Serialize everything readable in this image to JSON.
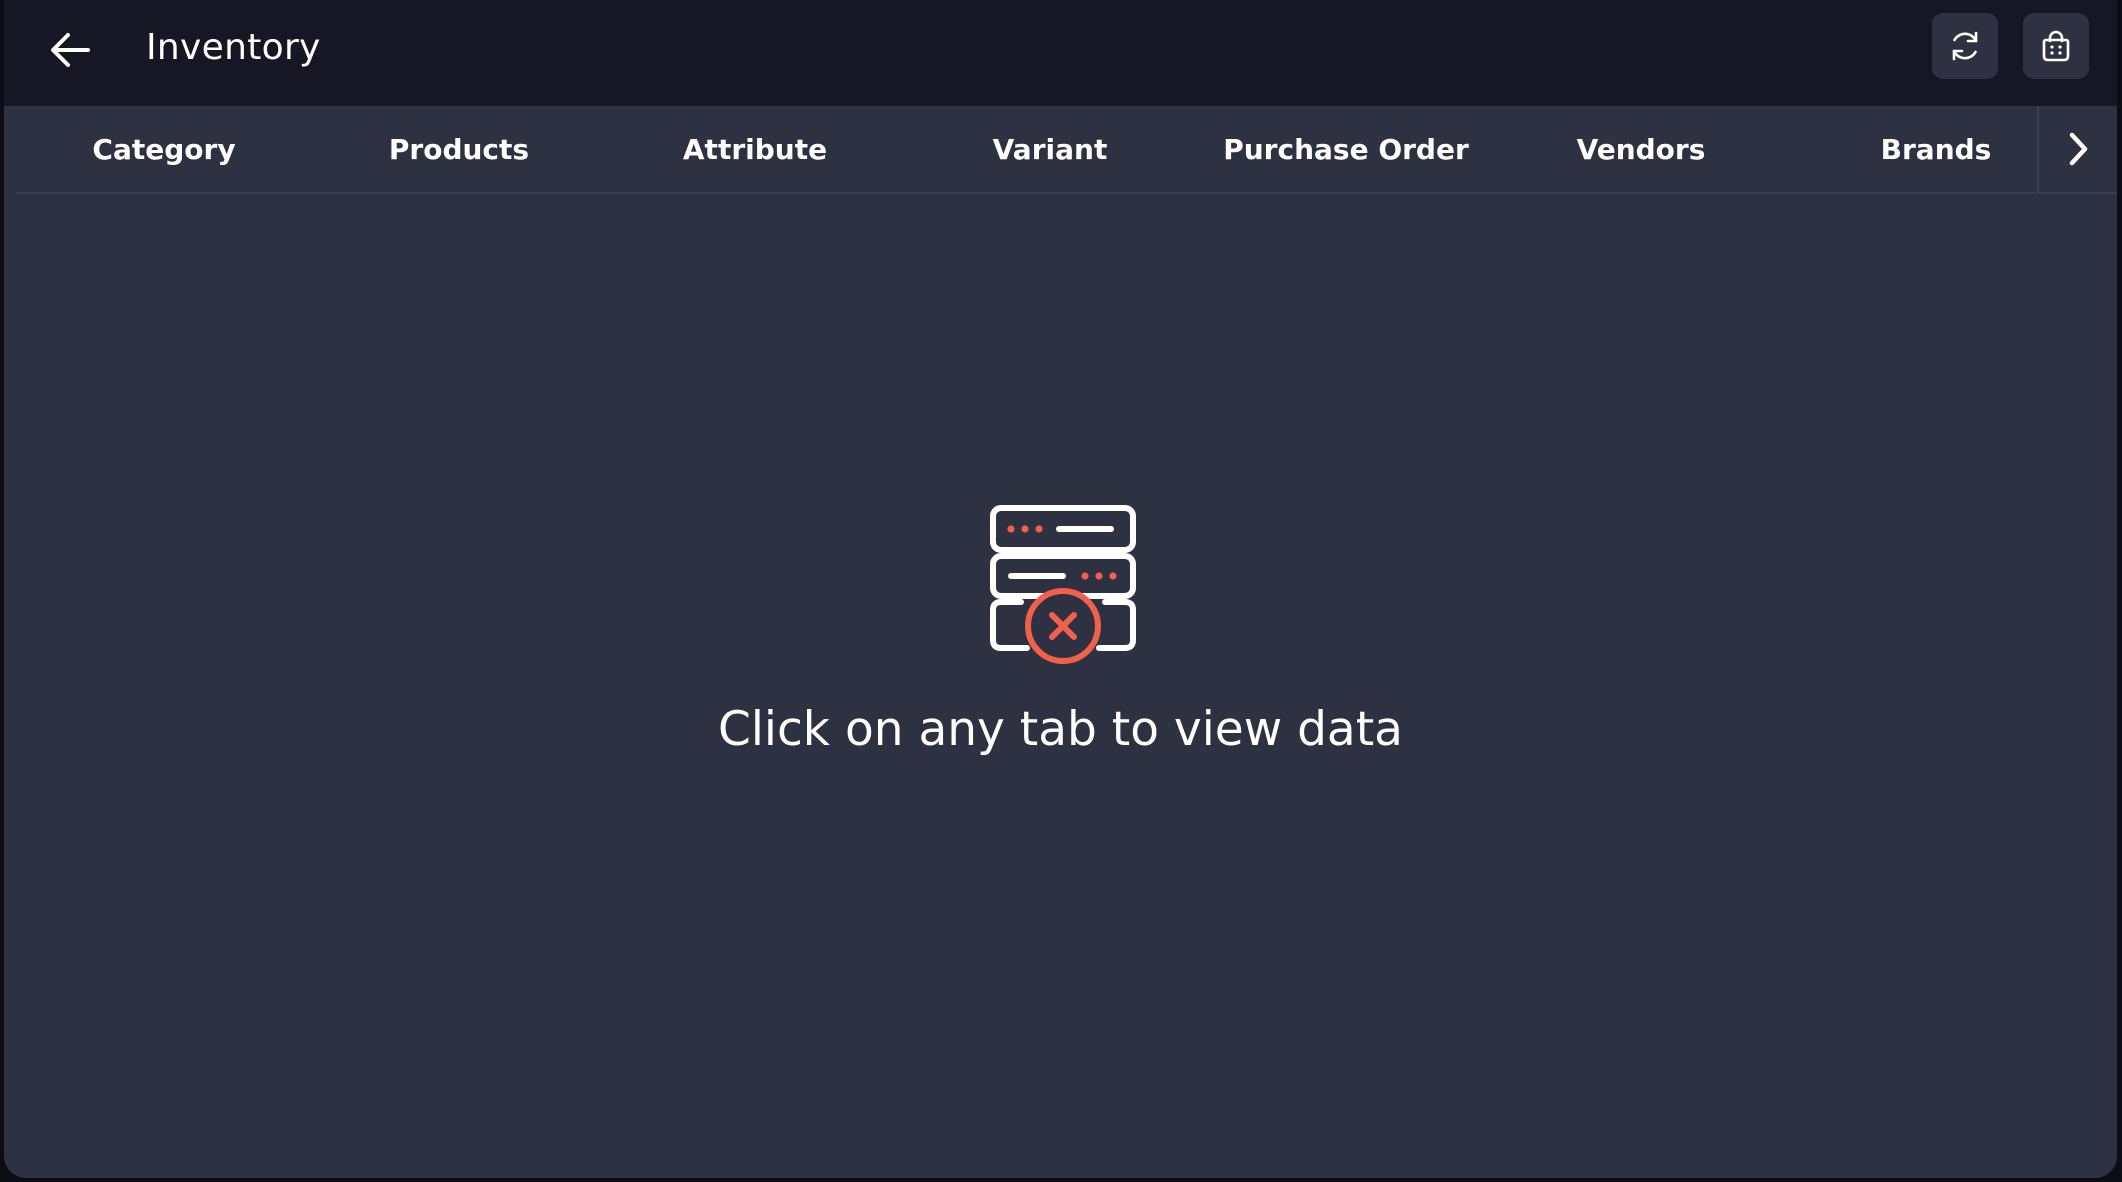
{
  "header": {
    "title": "Inventory",
    "back_icon": "arrow-left-icon",
    "actions": [
      {
        "name": "refresh",
        "icon": "refresh-icon"
      },
      {
        "name": "shop",
        "icon": "shopping-bag-icon"
      }
    ]
  },
  "tabs": [
    {
      "label": "Category"
    },
    {
      "label": "Products"
    },
    {
      "label": "Attribute"
    },
    {
      "label": "Variant"
    },
    {
      "label": "Purchase Order"
    },
    {
      "label": "Vendors"
    },
    {
      "label": "Brands"
    }
  ],
  "tabs_next_icon": "chevron-right-icon",
  "empty_state": {
    "icon": "server-error-icon",
    "message": "Click on any tab to view data"
  },
  "colors": {
    "background": "#2e3142",
    "topbar": "#161625",
    "accent": "#f0604a",
    "text": "#ffffff"
  }
}
